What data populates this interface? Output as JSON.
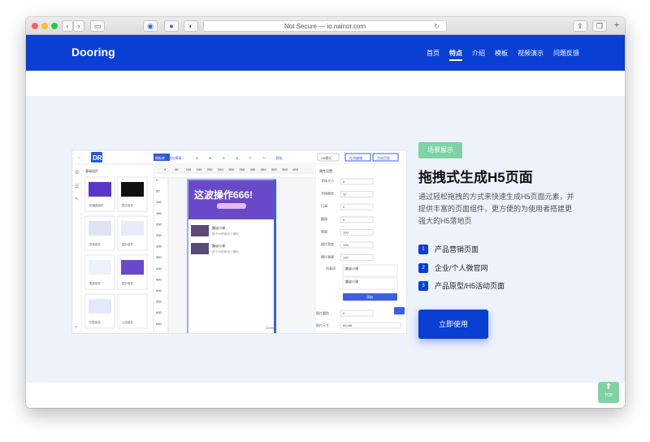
{
  "browser": {
    "url": "Not Secure — io.nainor.com",
    "new_tab": "+"
  },
  "nav": {
    "brand": "Dooring",
    "items": [
      "首页",
      "特点",
      "介绍",
      "模板",
      "视频演示",
      "问题反馈"
    ],
    "active_index": 1
  },
  "section": {
    "tag": "场景展示",
    "title": "拖拽式生成H5页面",
    "description": "通过轻松拖拽的方式来快速生成H5页面元素，并提供丰富的页面组件，更方便的为使用者搭建更强大的H5落地页",
    "features": [
      {
        "num": "1",
        "label": "产品营销页面"
      },
      {
        "num": "2",
        "label": "企业/个人微官网"
      },
      {
        "num": "3",
        "label": "产品原型/H5活动页面"
      }
    ],
    "cta": "立即使用"
  },
  "editor_preview": {
    "logo": "DR",
    "toolbar": [
      "模板库",
      "保存模板",
      "↓",
      "⟲",
      "⊕",
      "⊖",
      "⊗",
      "↶",
      "↷",
      "预览"
    ],
    "mode_select": "H5模式",
    "right_buttons": [
      "在线编辑",
      "生成页面"
    ],
    "component_title": "基础组件",
    "components": [
      "轮播图组件",
      "图文组件",
      "表单组件",
      "图片组件",
      "图表组件",
      "图片组件",
      "列表组件",
      "公告组件"
    ],
    "ruler_x": [
      "0",
      "50",
      "100",
      "150",
      "200",
      "250",
      "300",
      "350",
      "400",
      "450",
      "500",
      "550",
      "600"
    ],
    "ruler_y": [
      "0",
      "50",
      "100",
      "150",
      "200",
      "250",
      "300",
      "350",
      "400",
      "450",
      "500",
      "550",
      "600",
      "650"
    ],
    "banner_text": "这波操作666!",
    "list_items": [
      {
        "title": "趣谈小课",
        "sub": "基于H5的趣谈小课程"
      },
      {
        "title": "趣谈小课",
        "sub": "基于H5的趣谈小课程"
      }
    ],
    "zoom": "100%",
    "prop_title": "属性设置",
    "props": [
      {
        "label": "字体大小",
        "value": "0"
      },
      {
        "label": "字体颜色",
        "value": "12"
      },
      {
        "label": "行高",
        "value": "0"
      },
      {
        "label": "圆角",
        "value": "0"
      },
      {
        "label": "宽度",
        "value": "100"
      },
      {
        "label": "图片宽度",
        "value": "100"
      },
      {
        "label": "图片高度",
        "value": "100"
      }
    ],
    "list_data_label": "列表项",
    "list_data_items": [
      "趣谈小课",
      "趣谈小课"
    ],
    "add_button": "添加",
    "img_round_label": "图片圆角",
    "img_round_value": "0",
    "img_size_label": "图片尺寸",
    "img_size_value": "80×80"
  },
  "back_to_top": "TOP"
}
